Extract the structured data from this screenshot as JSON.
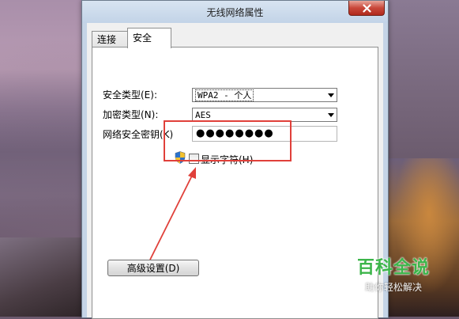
{
  "window": {
    "title": "无线网络属性"
  },
  "tabs": [
    {
      "label": "连接",
      "active": false
    },
    {
      "label": "安全",
      "active": true
    }
  ],
  "security": {
    "type_label": "安全类型(E):",
    "type_value": "WPA2 - 个人",
    "encryption_label": "加密类型(N):",
    "encryption_value": "AES",
    "key_label": "网络安全密钥(K)",
    "key_value": "●●●●●●●●",
    "show_chars_label": "显示字符(H)",
    "show_chars_checked": false
  },
  "advanced_button": "高级设置(D)",
  "watermark": {
    "title": "百科全说",
    "subtitle": "助你轻松解决"
  },
  "colors": {
    "highlight": "#e0403a",
    "watermark": "#3cb54a"
  }
}
